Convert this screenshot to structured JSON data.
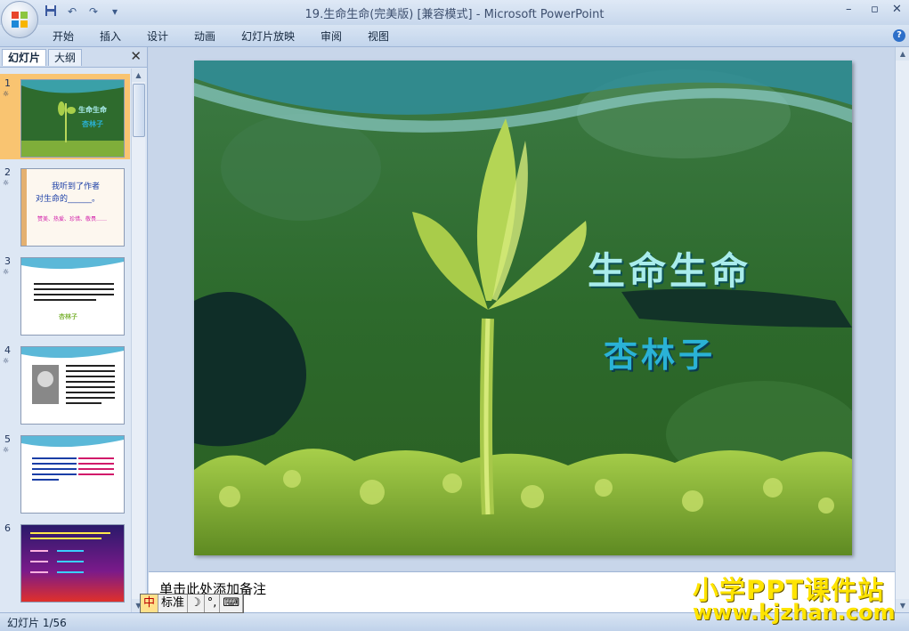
{
  "window": {
    "title": "19.生命生命(完美版) [兼容模式] - Microsoft PowerPoint",
    "controls": [
      "–",
      "▫",
      "✕"
    ]
  },
  "quick_access": {
    "save_icon": "save-icon",
    "undo_icon": "undo-icon",
    "redo_icon": "redo-icon"
  },
  "ribbon": {
    "tabs": [
      "开始",
      "插入",
      "设计",
      "动画",
      "幻灯片放映",
      "审阅",
      "视图"
    ],
    "help": "?"
  },
  "left_pane": {
    "tabs": [
      "幻灯片",
      "大纲"
    ],
    "close": "✕",
    "thumbnails": [
      {
        "num": "1",
        "anim": "☼",
        "title": "生命生命",
        "author": "杏林子",
        "selected": true
      },
      {
        "num": "2",
        "anim": "☼",
        "line1": "我听到了作者",
        "line2": "对生命的______。",
        "line3": "赞美、热爱、珍惜、敬畏……",
        "selected": false
      },
      {
        "num": "3",
        "anim": "☼",
        "label": "杏林子",
        "selected": false
      },
      {
        "num": "4",
        "anim": "☼",
        "selected": false
      },
      {
        "num": "5",
        "anim": "☼",
        "selected": false
      },
      {
        "num": "6",
        "anim": "",
        "selected": false
      }
    ]
  },
  "slide": {
    "title": "生命生命",
    "author": "杏林子"
  },
  "notes": {
    "placeholder": "单击此处添加备注"
  },
  "ime": {
    "mode": "标准",
    "moon": "☽",
    "punct": "°,",
    "keyboard": "⌨"
  },
  "status": {
    "slide_counter": "幻灯片 1/56"
  },
  "watermark": {
    "line1": "小学PPT课件站",
    "line2": "www.kjzhan.com"
  },
  "colors": {
    "slide_green": "#2d6a2c",
    "title_cyan": "#a9ecec",
    "author_blue": "#2ab2d6",
    "selected_thumb": "#f9c471",
    "watermark_yellow": "#ffe400"
  }
}
